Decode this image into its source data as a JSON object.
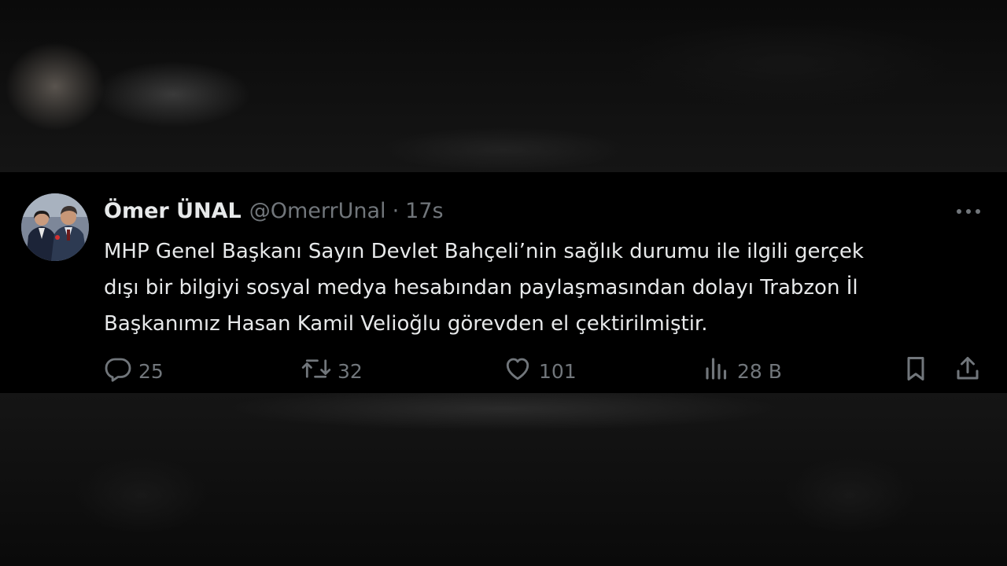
{
  "tweet": {
    "author_name": "Ömer ÜNAL",
    "handle": "@OmerrUnal",
    "separator": "·",
    "time": "17s",
    "lines": [
      "MHP Genel Başkanı Sayın Devlet Bahçeli’nin sağlık durumu ile ilgili gerçek",
      "dışı bir bilgiyi sosyal medya hesabından paylaşmasından dolayı Trabzon İl",
      "Başkanımız Hasan Kamil Velioğlu görevden el çektirilmiştir."
    ]
  },
  "actions": {
    "replies": "25",
    "reposts": "32",
    "likes": "101",
    "views": "28 B"
  },
  "icons": {
    "reply": "reply-icon",
    "repost": "repost-icon",
    "like": "heart-icon",
    "views": "views-icon",
    "bookmark": "bookmark-icon",
    "share": "share-icon",
    "more": "more-icon"
  },
  "colors": {
    "background": "#000000",
    "primary_text": "#e7e9ea",
    "secondary_text": "#71767b"
  }
}
